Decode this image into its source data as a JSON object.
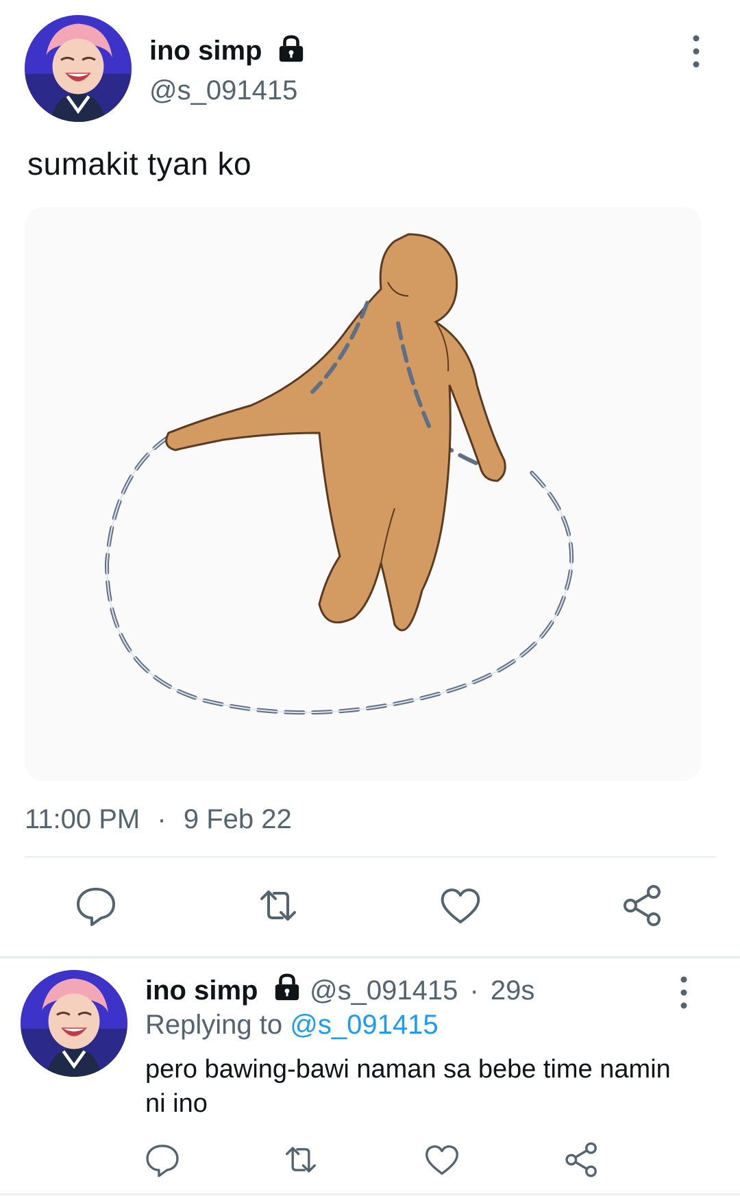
{
  "tweet": {
    "author_name": "ino simp",
    "author_handle": "@s_091415",
    "text": "sumakit tyan ko",
    "media_alt_icon": "jump-rope-figure-illustration",
    "time": "11:00 PM",
    "separator": "·",
    "date": "9 Feb 22",
    "icons": [
      "reply-icon",
      "retweet-icon",
      "like-icon",
      "share-icon"
    ]
  },
  "reply": {
    "author_name": "ino simp",
    "author_handle": "@s_091415",
    "separator": "·",
    "elapsed": "29s",
    "replying_prefix": "Replying to",
    "replying_to": "@s_091415",
    "text": "pero bawing-bawi naman sa bebe time namin ni ino"
  },
  "colors": {
    "text": "#0f1419",
    "secondary": "#536471",
    "link": "#1d9bf0",
    "divider": "#e6ecf0"
  }
}
